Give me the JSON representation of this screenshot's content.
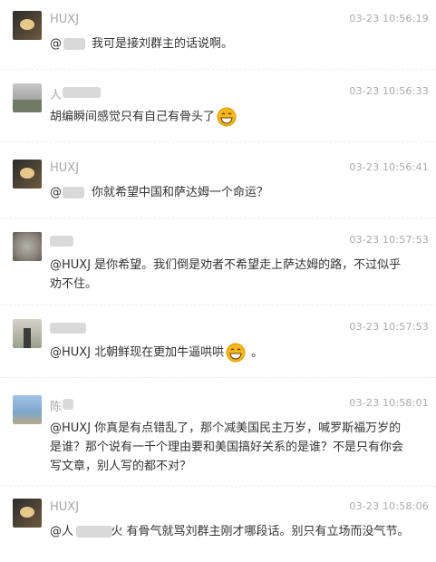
{
  "comments": [
    {
      "user": "HUXJ",
      "time": "03-23 10:56:19",
      "text": "@        我可是接刘群主的话说啊。"
    },
    {
      "user": "人",
      "time": "03-23 10:56:33",
      "text": "胡编瞬间感觉只有自己有骨头了"
    },
    {
      "user": "HUXJ",
      "time": "03-23 10:56:41",
      "text": "@        你就希望中国和萨达姆一个命运？"
    },
    {
      "user": "",
      "time": "03-23 10:57:53",
      "text": "@HUXJ 是你希望。我们倒是劝者不希望走上萨达姆的路，不过似乎劝不住。"
    },
    {
      "user": "",
      "time": "03-23 10:57:53",
      "text": "@HUXJ 北朝鲜现在更加牛逼哄哄"
    },
    {
      "user": "陈",
      "time": "03-23 10:58:01",
      "text": "@HUXJ 你真是有点错乱了，那个减美国民主万岁，喊罗斯福万岁的是谁？那个说有一千个理由要和美国搞好关系的是谁？不是只有你会写文章，别人写的都不对？"
    },
    {
      "user": "HUXJ",
      "time": "03-23 10:58:06",
      "text": "@人          火 有骨气就骂刘群主刚才哪段话。别只有立场而没气节。"
    }
  ],
  "emoji": "grinning-face-icon",
  "emoji_trailing_period": "。",
  "colors": {
    "username": "#a8a8a8",
    "timestamp": "#aaaaaa",
    "text": "#333333",
    "emoji": "#f5b81c"
  }
}
